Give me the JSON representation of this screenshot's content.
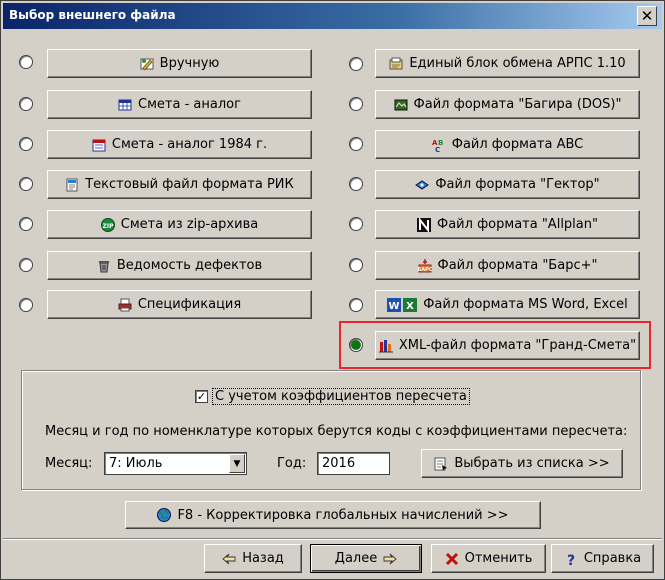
{
  "window": {
    "title": "Выбор внешнего файла",
    "close_label": "✕"
  },
  "left_options": [
    {
      "label": "Вручную",
      "icon": "hand-pencil-icon",
      "selected": false
    },
    {
      "label": "Смета - аналог",
      "icon": "table-icon",
      "selected": false
    },
    {
      "label": "Смета - аналог 1984 г.",
      "icon": "calendar-icon",
      "selected": false
    },
    {
      "label": "Текстовый файл формата РИК",
      "icon": "text-file-icon",
      "selected": false
    },
    {
      "label": "Смета из zip-архива",
      "icon": "zip-icon",
      "selected": false
    },
    {
      "label": "Ведомость дефектов",
      "icon": "defect-icon",
      "selected": false
    },
    {
      "label": "Спецификация",
      "icon": "printer-icon",
      "selected": false
    }
  ],
  "right_options": [
    {
      "label": "Единый блок обмена АРПС 1.10",
      "icon": "exchange-block-icon",
      "selected": false
    },
    {
      "label": "Файл формата \"Багира (DOS)\"",
      "icon": "bagira-icon",
      "selected": false
    },
    {
      "label": "Файл формата ABC",
      "icon": "abc-icon",
      "selected": false
    },
    {
      "label": "Файл формата \"Гектор\"",
      "icon": "gektor-icon",
      "selected": false
    },
    {
      "label": "Файл формата \"Allplan\"",
      "icon": "allplan-icon",
      "selected": false
    },
    {
      "label": "Файл формата \"Барс+\"",
      "icon": "bars-icon",
      "selected": false
    },
    {
      "label": "Файл формата MS Word, Excel",
      "icon": "word-excel-icon",
      "selected": false
    },
    {
      "label": "XML-файл формата \"Гранд-Смета\"",
      "icon": "xml-icon",
      "selected": true
    }
  ],
  "recalc": {
    "checkbox_label": "С учетом коэффициентов пересчета",
    "checked": true,
    "check_mark": "✓",
    "description": "Месяц и год по номенклатуре которых берутся коды  с коэффициентами пересчета:",
    "month_label": "Месяц:",
    "month_value": "7: Июль",
    "year_label": "Год:",
    "year_value": "2016",
    "choose_button": "Выбрать из списка >>"
  },
  "global_button": "F8 - Корректировка глобальных начислений >>",
  "footer": {
    "back": "Назад",
    "next": "Далее",
    "cancel": "Отменить",
    "help": "Справка"
  },
  "colors": {
    "selected_radio": "#107410",
    "highlight_frame": "#e8262c",
    "title_bar": "#0a246a"
  }
}
